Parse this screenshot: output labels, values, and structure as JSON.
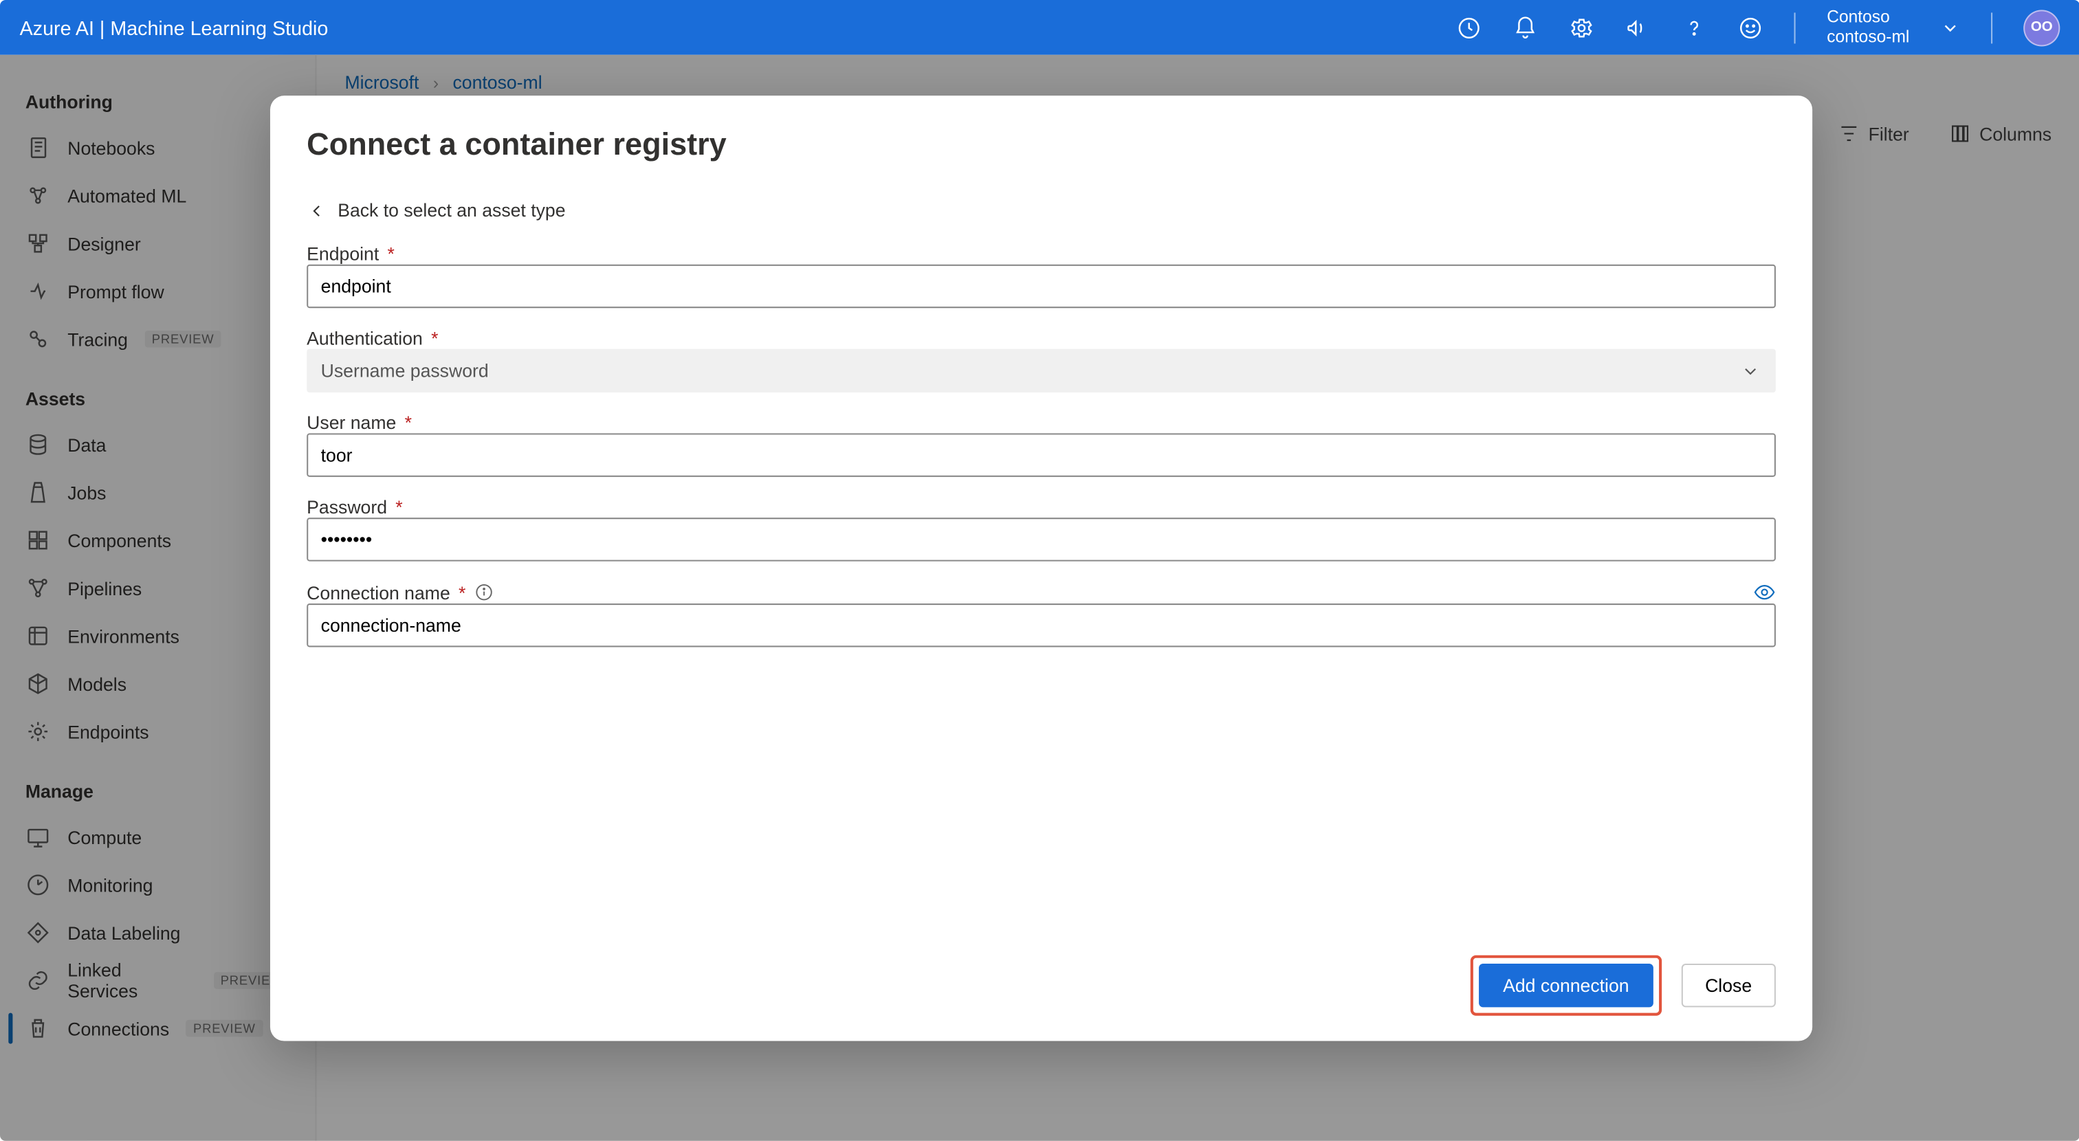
{
  "topbar": {
    "title": "Azure AI | Machine Learning Studio",
    "org": "Contoso",
    "workspace": "contoso-ml",
    "avatar_initials": "OO"
  },
  "breadcrumb": {
    "items": [
      "Microsoft",
      "contoso-ml"
    ]
  },
  "sidebar": {
    "sections": [
      {
        "label": "Authoring",
        "items": [
          {
            "icon": "notebook",
            "label": "Notebooks"
          },
          {
            "icon": "automl",
            "label": "Automated ML"
          },
          {
            "icon": "designer",
            "label": "Designer"
          },
          {
            "icon": "flow",
            "label": "Prompt flow"
          },
          {
            "icon": "tracing",
            "label": "Tracing",
            "preview": true
          }
        ]
      },
      {
        "label": "Assets",
        "items": [
          {
            "icon": "data",
            "label": "Data"
          },
          {
            "icon": "jobs",
            "label": "Jobs"
          },
          {
            "icon": "components",
            "label": "Components"
          },
          {
            "icon": "pipelines",
            "label": "Pipelines"
          },
          {
            "icon": "env",
            "label": "Environments"
          },
          {
            "icon": "models",
            "label": "Models"
          },
          {
            "icon": "endpoints",
            "label": "Endpoints"
          }
        ]
      },
      {
        "label": "Manage",
        "items": [
          {
            "icon": "compute",
            "label": "Compute"
          },
          {
            "icon": "monitoring",
            "label": "Monitoring"
          },
          {
            "icon": "datalabel",
            "label": "Data Labeling"
          },
          {
            "icon": "linked",
            "label": "Linked Services",
            "preview": true
          },
          {
            "icon": "connections",
            "label": "Connections",
            "preview": true,
            "active": true
          }
        ]
      }
    ]
  },
  "toolbar": {
    "filter": "Filter",
    "columns": "Columns"
  },
  "modal": {
    "title": "Connect a container registry",
    "back_label": "Back to select an asset type",
    "fields": {
      "endpoint_label": "Endpoint",
      "endpoint_value": "endpoint",
      "auth_label": "Authentication",
      "auth_value": "Username password",
      "username_label": "User name",
      "username_value": "toor",
      "password_label": "Password",
      "password_value": "••••••••",
      "connection_label": "Connection name",
      "connection_value": "connection-name"
    },
    "buttons": {
      "primary": "Add connection",
      "secondary": "Close"
    }
  },
  "badges": {
    "preview": "PREVIEW"
  }
}
